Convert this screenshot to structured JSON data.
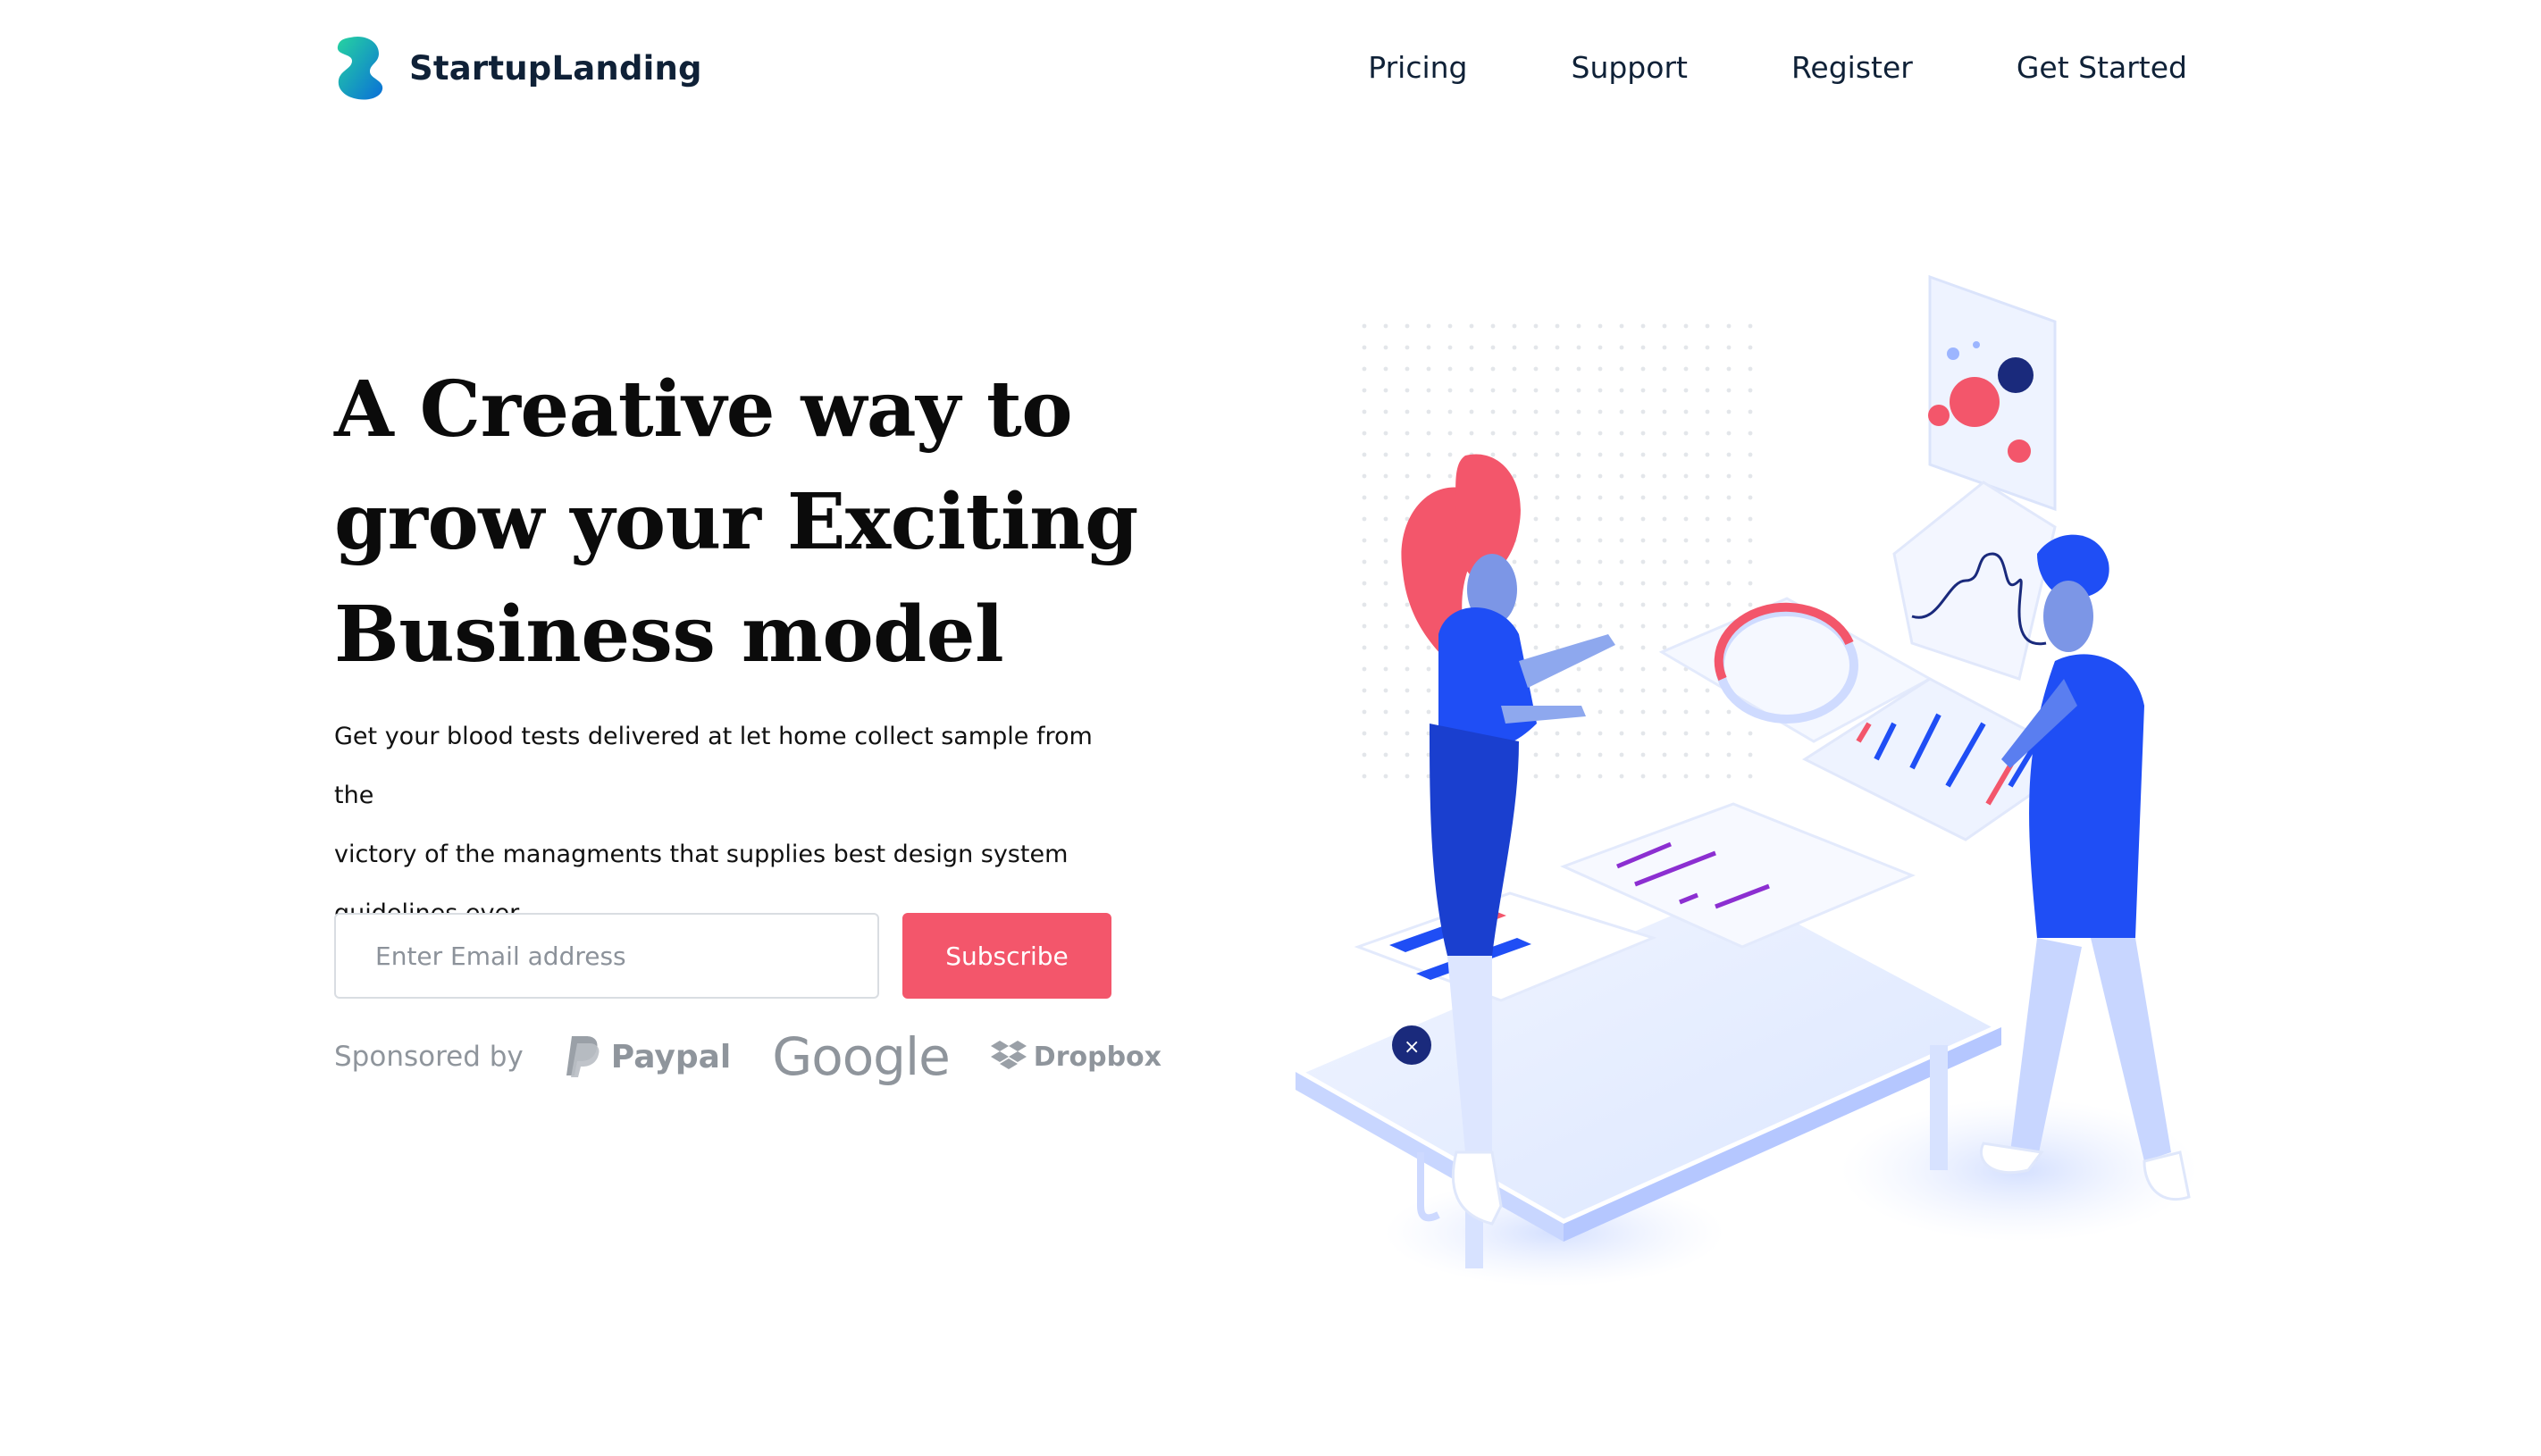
{
  "brand": {
    "name": "StartupLanding"
  },
  "nav": {
    "items": [
      {
        "label": "Pricing"
      },
      {
        "label": "Support"
      },
      {
        "label": "Register"
      },
      {
        "label": "Get Started"
      }
    ]
  },
  "hero": {
    "title_lines": [
      "A Creative way to",
      "grow your Exciting",
      "Business model"
    ],
    "description_lines": [
      "Get your blood tests delivered at let home collect sample from the",
      "victory of the managments that supplies best design system",
      "guidelines ever."
    ]
  },
  "subscribe": {
    "placeholder": "Enter Email address",
    "button_label": "Subscribe"
  },
  "sponsors": {
    "label": "Sponsored by",
    "brands": [
      {
        "name": "Paypal",
        "icon": "paypal-icon"
      },
      {
        "name": "Google",
        "icon": ""
      },
      {
        "name": "Dropbox",
        "icon": "dropbox-icon"
      }
    ]
  },
  "colors": {
    "accent": "#f3566b",
    "text": "#0f2137",
    "muted": "#8f959c",
    "illustration_blue": "#1f4ef5",
    "illustration_red": "#f3566b"
  }
}
